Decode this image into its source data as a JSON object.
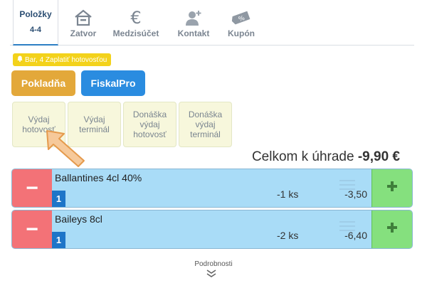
{
  "nav": {
    "tabs": [
      {
        "label_line1": "Položky",
        "label_line2": "4-4",
        "icon": "list",
        "active": true
      },
      {
        "label": "Zatvor",
        "icon": "house-icon"
      },
      {
        "label": "Medzisúčet",
        "icon": "euro-icon"
      },
      {
        "label": "Kontakt",
        "icon": "person-add-icon"
      },
      {
        "label": "Kupón",
        "icon": "coupon-tag-icon"
      }
    ]
  },
  "notice": {
    "text": "Bar, 4 Zaplatiť hotovosťou"
  },
  "buttons": {
    "pokladna": "Pokladňa",
    "fiskalpro": "FiskalPro"
  },
  "options": [
    {
      "line1": "Výdaj",
      "line2": "hotovosť",
      "line3": ""
    },
    {
      "line1": "Výdaj",
      "line2": "terminál",
      "line3": ""
    },
    {
      "line1": "Donáška",
      "line2": "výdaj",
      "line3": "hotovosť"
    },
    {
      "line1": "Donáška",
      "line2": "výdaj",
      "line3": "terminál"
    }
  ],
  "total": {
    "label": "Celkom k úhrade",
    "value": "-9,90 €"
  },
  "items": [
    {
      "name": "Ballantines 4cl 40%",
      "qty_badge": "1",
      "qty": "-1 ks",
      "price": "-3,50"
    },
    {
      "name": "Baileys 8cl",
      "qty_badge": "1",
      "qty": "-2 ks",
      "price": "-6,40"
    }
  ],
  "footer": {
    "details": "Podrobnosti"
  },
  "colors": {
    "accent_blue": "#2a8ce0",
    "orange": "#e3a83a",
    "row_bg": "#a9dcf7",
    "minus": "#f37277",
    "plus": "#85e07e",
    "notice": "#f3d21b"
  }
}
